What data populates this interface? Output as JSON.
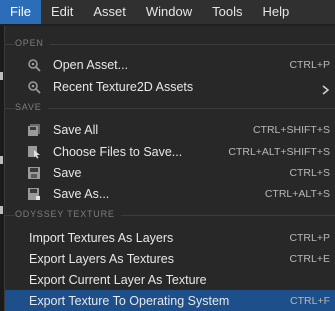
{
  "menubar": {
    "items": [
      {
        "label": "File",
        "active": true
      },
      {
        "label": "Edit"
      },
      {
        "label": "Asset"
      },
      {
        "label": "Window"
      },
      {
        "label": "Tools"
      },
      {
        "label": "Help"
      }
    ]
  },
  "sections": {
    "open": "OPEN",
    "save": "SAVE",
    "odyssey": "ODYSSEY TEXTURE"
  },
  "items": {
    "open_asset": {
      "label": "Open Asset...",
      "shortcut": "CTRL+P",
      "icon": "gear-search-icon"
    },
    "recent": {
      "label": "Recent Texture2D Assets",
      "icon": "gear-search-icon"
    },
    "save_all": {
      "label": "Save All",
      "shortcut": "CTRL+SHIFT+S",
      "icon": "save-all-icon"
    },
    "choose_files": {
      "label": "Choose Files to Save...",
      "shortcut": "CTRL+ALT+SHIFT+S",
      "icon": "choose-files-icon"
    },
    "save": {
      "label": "Save",
      "shortcut": "CTRL+S",
      "icon": "save-icon"
    },
    "save_as": {
      "label": "Save As...",
      "shortcut": "CTRL+ALT+S",
      "icon": "save-as-icon"
    },
    "import_textures": {
      "label": "Import Textures As Layers",
      "shortcut": "CTRL+P"
    },
    "export_layers": {
      "label": "Export Layers As Textures",
      "shortcut": "CTRL+E"
    },
    "export_current": {
      "label": "Export Current Layer As Texture"
    },
    "export_os": {
      "label": "Export Texture To Operating System",
      "shortcut": "CTRL+F",
      "selected": true
    }
  },
  "colors": {
    "accent": "#2b6db6",
    "selected_row": "#1d4f8a",
    "menu_bg": "#282828"
  }
}
